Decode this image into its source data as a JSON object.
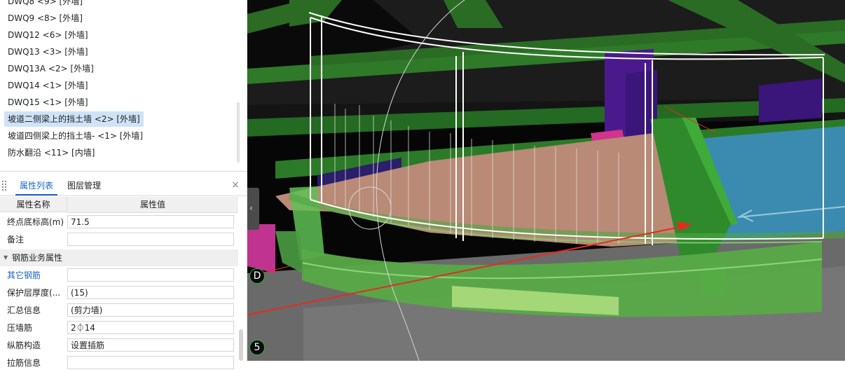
{
  "tree": {
    "items": [
      {
        "label": "DWQ8 <9> [外墙]",
        "selected": false
      },
      {
        "label": "DWQ9 <8> [外墙]",
        "selected": false
      },
      {
        "label": "DWQ12 <6> [外墙]",
        "selected": false
      },
      {
        "label": "DWQ13 <3> [外墙]",
        "selected": false
      },
      {
        "label": "DWQ13A <2> [外墙]",
        "selected": false
      },
      {
        "label": "DWQ14 <1> [外墙]",
        "selected": false
      },
      {
        "label": "DWQ15 <1> [外墙]",
        "selected": false
      },
      {
        "label": "坡道二侧梁上的挡土墙 <2> [外墙]",
        "selected": true
      },
      {
        "label": "坡道四侧梁上的挡土墙- <1> [外墙]",
        "selected": false
      },
      {
        "label": "防水翻沿 <11> [内墙]",
        "selected": false
      }
    ]
  },
  "panel": {
    "tabs": [
      {
        "label": "属性列表",
        "active": true
      },
      {
        "label": "图层管理",
        "active": false
      }
    ],
    "close_icon": "×",
    "columns": {
      "name": "属性名称",
      "value": "属性值"
    },
    "rows_top": [
      {
        "name": "终点底标高(m)",
        "value": "71.5"
      },
      {
        "name": "备注",
        "value": ""
      }
    ],
    "section": "钢筋业务属性",
    "rows_rebar": [
      {
        "name": "其它钢筋",
        "value": "",
        "link": true
      },
      {
        "name": "保护层厚度(...",
        "value": "(15)",
        "link": false
      },
      {
        "name": "汇总信息",
        "value": "(剪力墙)",
        "link": false
      },
      {
        "name": "压墙筋",
        "value": "2⏀14",
        "link": false
      },
      {
        "name": "纵筋构造",
        "value": "设置插筋",
        "link": false
      },
      {
        "name": "拉筋信息",
        "value": "",
        "link": false
      }
    ]
  },
  "viewport": {
    "axis_labels": [
      "D",
      "5"
    ],
    "collapse_icon": "‹"
  },
  "colors": {
    "selected_bg": "#cfe3f8",
    "tab_active": "#1a66c2",
    "wall_green": "#3f9a36",
    "annotation_red": "#e52b1f",
    "slab_salmon": "#b98a75",
    "water_blue": "#3b8bb0",
    "column_purple": "#4a1a8c"
  }
}
